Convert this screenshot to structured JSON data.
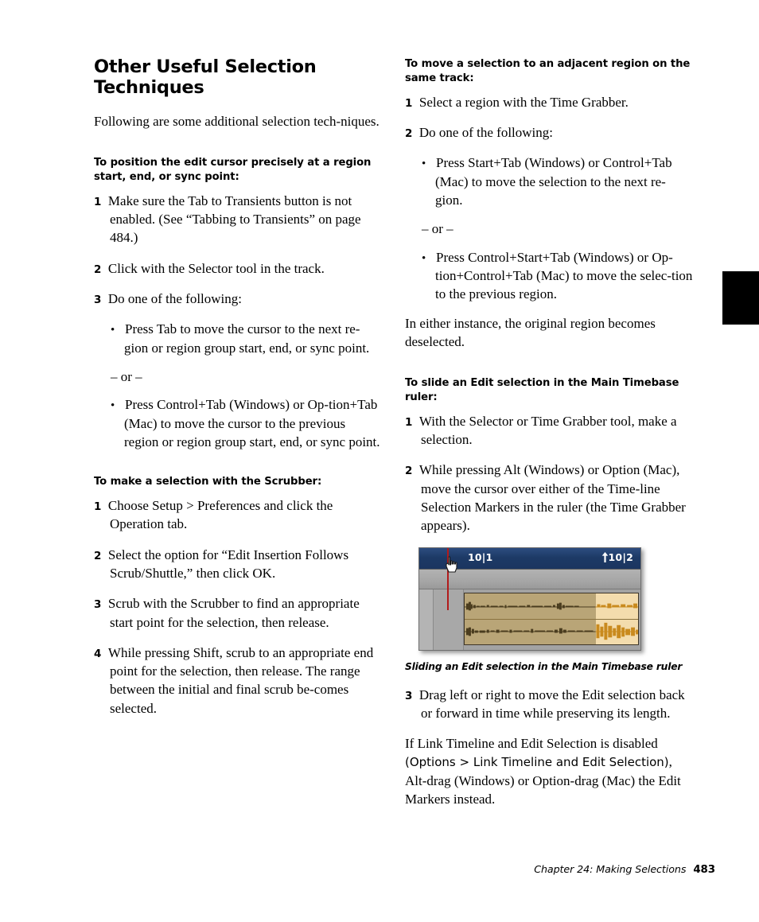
{
  "page": {
    "number": "483",
    "footer_text": "Chapter 24: Making Selections"
  },
  "left_column": {
    "section_title": "Other Useful Selection Techniques",
    "intro": "Following are some additional selection tech-niques.",
    "block1": {
      "heading": "To position the edit cursor precisely at a region start, end, or sync point:",
      "step1_num": "1",
      "step1_text": "Make sure the Tab to Transients button is not enabled. (See “Tabbing to Transients” on page 484.)",
      "step2_num": "2",
      "step2_text": "Click with the Selector tool in the track.",
      "step3_num": "3",
      "step3_text": "Do one of the following:",
      "bullet1": "Press Tab to move the cursor to the next re-gion or region group start, end, or sync point.",
      "or_separator": "– or –",
      "bullet2": "Press Control+Tab (Windows) or Op-tion+Tab (Mac) to move the cursor to the previous region or region group start, end, or sync point."
    },
    "block2": {
      "heading": "To make a selection with the Scrubber:",
      "step1_num": "1",
      "step1_text": "Choose Setup > Preferences and click the Operation tab.",
      "step2_num": "2",
      "step2_text": "Select the option for “Edit Insertion Follows Scrub/Shuttle,” then click OK.",
      "step3_num": "3",
      "step3_text": "Scrub with the Scrubber to find an appropriate start point for the selection, then release.",
      "step4_num": "4",
      "step4_text": "While pressing Shift, scrub to an appropriate end point for the selection, then release. The range between the initial and final scrub be-comes selected."
    }
  },
  "right_column": {
    "block1": {
      "heading": "To move a selection to an adjacent region on the same track:",
      "step1_num": "1",
      "step1_text": "Select a region with the Time Grabber.",
      "step2_num": "2",
      "step2_text": "Do one of the following:",
      "bullet1": "Press Start+Tab (Windows) or Control+Tab (Mac) to move the selection to the next re-gion.",
      "or_separator": "– or –",
      "bullet2": "Press Control+Start+Tab (Windows) or Op-tion+Control+Tab (Mac) to move the selec-tion to the previous region.",
      "closing": "In either instance, the original region becomes deselected."
    },
    "block2": {
      "heading": "To slide an Edit selection in the Main Timebase ruler:",
      "step1_num": "1",
      "step1_text": "With the Selector or Time Grabber tool, make a selection.",
      "step2_num": "2",
      "step2_text": "While pressing Alt (Windows) or Option (Mac), move the cursor over either of the Time-line Selection Markers in the ruler (the Time Grabber appears)."
    },
    "figure": {
      "caption": "Sliding an Edit selection in the Main Timebase ruler",
      "ruler_label_left": "10|1",
      "ruler_label_right": "10|2",
      "ruler_marker_icon": "up-arrow-marker-icon",
      "cursor_icon": "hand-grabber-icon",
      "playhead_color": "#b21b1b",
      "ruler_color": "#1d3a66",
      "selected_clip_color": "#b9a577",
      "unselected_clip_color": "#f3dcad"
    },
    "block3": {
      "step3_num": "3",
      "step3_text": "Drag left or right to move the Edit selection back or forward in time while preserving its length.",
      "closing_part1": "If Link Timeline and Edit Selection is disabled ",
      "closing_sans": "(Options > Link Timeline and Edit Selection)",
      "closing_part2": ", Alt-drag (Windows) or Option-drag (Mac) the Edit Markers instead."
    }
  }
}
